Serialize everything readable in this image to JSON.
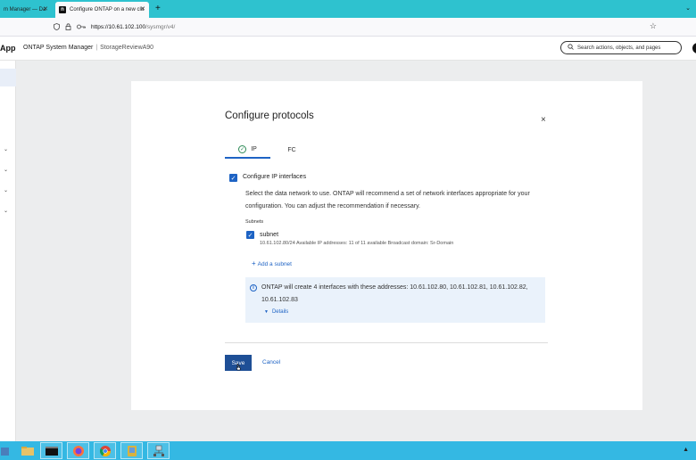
{
  "browser": {
    "tabs": [
      {
        "label": "m Manager — Da"
      },
      {
        "label": "Configure ONTAP on a new clu"
      }
    ],
    "url_host": "https://10.61.102.100",
    "url_path": "/sysmgr/v4/"
  },
  "header": {
    "brand": "App",
    "app_name": "ONTAP System Manager",
    "separator": "|",
    "cluster_name": "StorageReviewA90",
    "search_placeholder": "Search actions, objects, and pages"
  },
  "dialog": {
    "title": "Configure protocols",
    "close_glyph": "×",
    "tabs": [
      {
        "label": "IP"
      },
      {
        "label": "FC"
      }
    ],
    "configure_ip_label": "Configure IP interfaces",
    "description_line1": "Select the data network to use. ONTAP will recommend a set of network interfaces appropriate for your",
    "description_line2": "configuration. You can adjust the recommendation if necessary.",
    "subnets_header": "Subnets",
    "subnet": {
      "name": "subnet",
      "info": "10.61.102.80/24  Available IP addresses: 11 of 11 available  Broadcast domain: Sr-Domain"
    },
    "add_subnet_label": "Add a subnet",
    "info_line1": "ONTAP will create 4 interfaces with these addresses: 10.61.102.80, 10.61.102.81, 10.61.102.82,",
    "info_line2": "10.61.102.83",
    "details_label": "Details",
    "save_label": "Save",
    "cancel_label": "Cancel"
  },
  "colors": {
    "accent": "#1e63c4",
    "save_button": "#1e4f96",
    "tabstrip": "#2ec2cf",
    "taskbar": "#34b8e3",
    "info_bg": "#eaf2fb"
  }
}
